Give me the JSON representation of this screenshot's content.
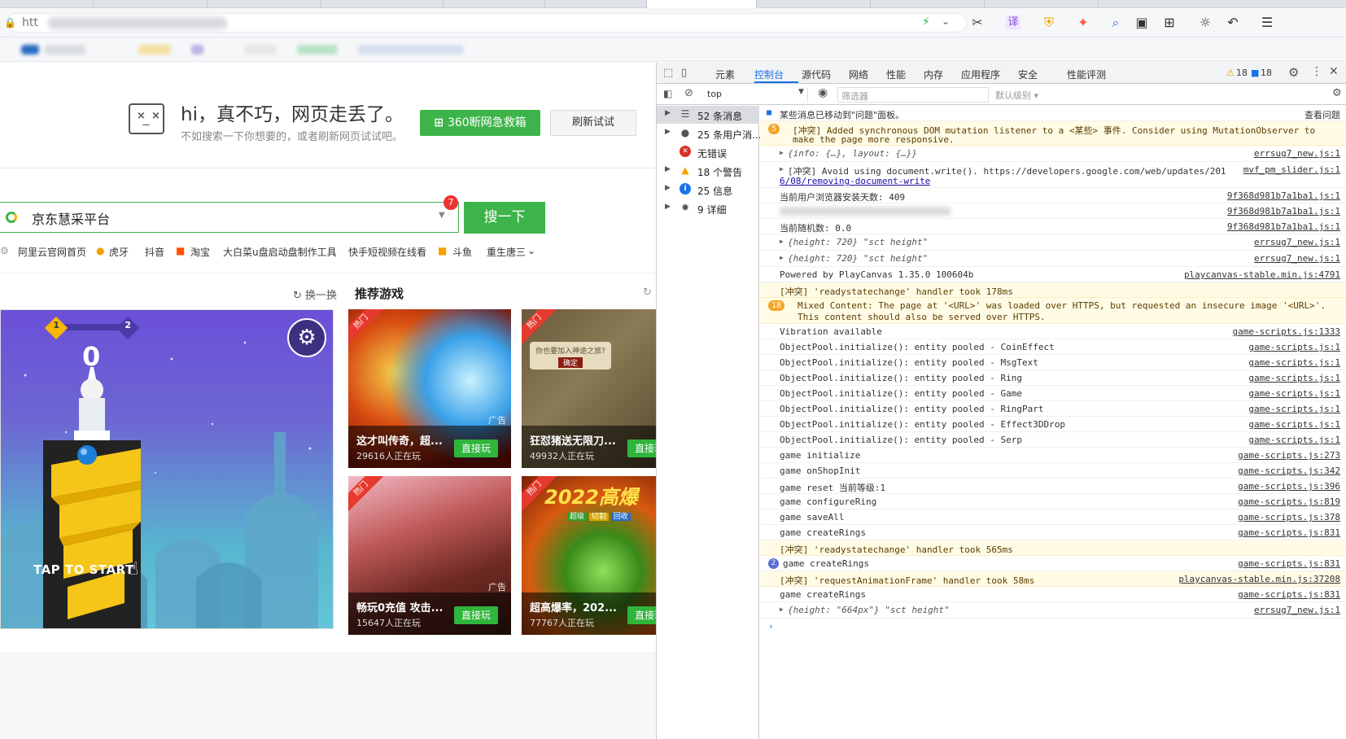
{
  "browser": {
    "address_prefix": "htt",
    "toolbar_icons": [
      "lightning-icon",
      "chevron-down-icon",
      "scissors-icon",
      "translate-icon",
      "shield-icon",
      "game-icon",
      "search-icon",
      "reader-icon",
      "grid-icon",
      "brightness-icon",
      "undo-icon",
      "menu-icon"
    ]
  },
  "error_page": {
    "title": "hi，真不巧，网页走丢了。",
    "subtitle": "不如搜索一下你想要的，或者刷新网页试试吧。",
    "rescue_button": "360断网急救箱",
    "retry_button": "刷新试试"
  },
  "search": {
    "query": "京东慧采平台",
    "badge": "7",
    "button": "搜一下"
  },
  "quicklinks": [
    "阿里云官网首页",
    "虎牙",
    "抖音",
    "淘宝",
    "大白菜u盘启动盘制作工具",
    "快手短视频在线看",
    "斗鱼",
    "重生唐三"
  ],
  "games": {
    "refresh_label": "换一换",
    "section_title": "推荐游戏",
    "big_game": {
      "level_from": "1",
      "level_to": "2",
      "score": "0",
      "tap_label": "TAP TO START"
    },
    "cards": [
      {
        "name": "这才叫传奇，超...",
        "players": "29616人正在玩",
        "button": "直接玩",
        "hot": "热门",
        "ad": "广告"
      },
      {
        "name": "狂怼猪送无限刀...",
        "players": "49932人正在玩",
        "button": "直接玩",
        "hot": "热门",
        "ad": ""
      },
      {
        "name": "畅玩0充值 攻击...",
        "players": "15647人正在玩",
        "button": "直接玩",
        "hot": "热门",
        "ad": "广告"
      },
      {
        "name": "超高爆率，202...",
        "players": "77767人正在玩",
        "button": "直接玩",
        "hot": "热门",
        "ad": ""
      }
    ],
    "card2_overlay": "你也要加入神途之旅?",
    "card2_confirm": "确定",
    "card4_overlay": "2022高爆",
    "card4_tags": [
      "超级",
      "切割",
      "回收"
    ]
  },
  "devtools": {
    "tabs": [
      "元素",
      "控制台",
      "源代码",
      "网络",
      "性能",
      "内存",
      "应用程序",
      "安全",
      "性能评测"
    ],
    "warn_count": "18",
    "info_count": "18",
    "context": "top",
    "filter_placeholder": "筛选器",
    "level": "默认级别",
    "sidebar": [
      {
        "label": "52 条消息",
        "icon": "list-icon"
      },
      {
        "label": "25 条用户消...",
        "icon": "user-icon"
      },
      {
        "label": "无错误",
        "icon": "error-icon"
      },
      {
        "label": "18 个警告",
        "icon": "warning-icon"
      },
      {
        "label": "25 信息",
        "icon": "info-icon"
      },
      {
        "label": "9 详细",
        "icon": "verbose-icon"
      }
    ],
    "console": [
      {
        "type": "info",
        "text": "某些消息已移动到\"问题\"面板。",
        "src": "查看问题"
      },
      {
        "type": "warn",
        "badge": "5",
        "text": "[冲突] Added synchronous DOM mutation listener to a <某些> 事件. Consider using MutationObserver to",
        "text2": "make the page more responsive.",
        "src": ""
      },
      {
        "type": "log",
        "obj": "{info: {…}, layout: {…}}",
        "src": "errsug7_new.js:1"
      },
      {
        "type": "log",
        "text": "[冲突] Avoid using document.write(). https://developers.google.com/web/updates/201",
        "text2": "6/08/removing-document-write",
        "src": "mvf_pm_slider.js:1"
      },
      {
        "type": "log",
        "text": "当前用户浏览器安装天数: 409",
        "src": "9f368d981b7a1ba1.js:1"
      },
      {
        "type": "log",
        "text": "",
        "src": "9f368d981b7a1ba1.js:1"
      },
      {
        "type": "log",
        "text": "当前随机数: 0.0",
        "src": "9f368d981b7a1ba1.js:1"
      },
      {
        "type": "log",
        "obj": "{height: 720} \"sct height\"",
        "src": "errsug7_new.js:1"
      },
      {
        "type": "log",
        "obj": "{height: 720} \"sct height\"",
        "src": "errsug7_new.js:1"
      },
      {
        "type": "log",
        "text": "Powered by PlayCanvas 1.35.0 100604b",
        "src": "playcanvas-stable.min.js:4791"
      },
      {
        "type": "warn",
        "text": "[冲突] 'readystatechange' handler took 178ms",
        "src": ""
      },
      {
        "type": "warn",
        "badge": "18",
        "text": "Mixed Content: The page at '<URL>' was loaded over HTTPS, but requested an insecure image '<URL>'.",
        "text2": "This content should also be served over HTTPS.",
        "src": ""
      },
      {
        "type": "log",
        "text": "Vibration available",
        "src": "game-scripts.js:1333"
      },
      {
        "type": "log",
        "text": "ObjectPool.initialize(): entity pooled - CoinEffect",
        "src": "game-scripts.js:1"
      },
      {
        "type": "log",
        "text": "ObjectPool.initialize(): entity pooled - MsgText",
        "src": "game-scripts.js:1"
      },
      {
        "type": "log",
        "text": "ObjectPool.initialize(): entity pooled - Ring",
        "src": "game-scripts.js:1"
      },
      {
        "type": "log",
        "text": "ObjectPool.initialize(): entity pooled - Game",
        "src": "game-scripts.js:1"
      },
      {
        "type": "log",
        "text": "ObjectPool.initialize(): entity pooled - RingPart",
        "src": "game-scripts.js:1"
      },
      {
        "type": "log",
        "text": "ObjectPool.initialize(): entity pooled - Effect3DDrop",
        "src": "game-scripts.js:1"
      },
      {
        "type": "log",
        "text": "ObjectPool.initialize(): entity pooled - Serp",
        "src": "game-scripts.js:1"
      },
      {
        "type": "log",
        "text": "game initialize",
        "src": "game-scripts.js:273"
      },
      {
        "type": "log",
        "text": "game onShopInit",
        "src": "game-scripts.js:342"
      },
      {
        "type": "log",
        "text": "game reset  当前等级:1",
        "src": "game-scripts.js:396"
      },
      {
        "type": "log",
        "text": "game configureRing",
        "src": "game-scripts.js:819"
      },
      {
        "type": "log",
        "text": "game saveAll",
        "src": "game-scripts.js:378"
      },
      {
        "type": "log",
        "text": "game createRings",
        "src": "game-scripts.js:831"
      },
      {
        "type": "warn",
        "text": "[冲突] 'readystatechange' handler took 565ms",
        "src": ""
      },
      {
        "type": "log",
        "count": "2",
        "text": "game createRings",
        "src": "game-scripts.js:831"
      },
      {
        "type": "warn",
        "text": "[冲突] 'requestAnimationFrame' handler took 58ms",
        "src": "playcanvas-stable.min.js:37208"
      },
      {
        "type": "log",
        "text": "game createRings",
        "src": "game-scripts.js:831"
      },
      {
        "type": "log",
        "obj": "{height: \"664px\"} \"sct height\"",
        "src": "errsug7_new.js:1"
      }
    ]
  }
}
